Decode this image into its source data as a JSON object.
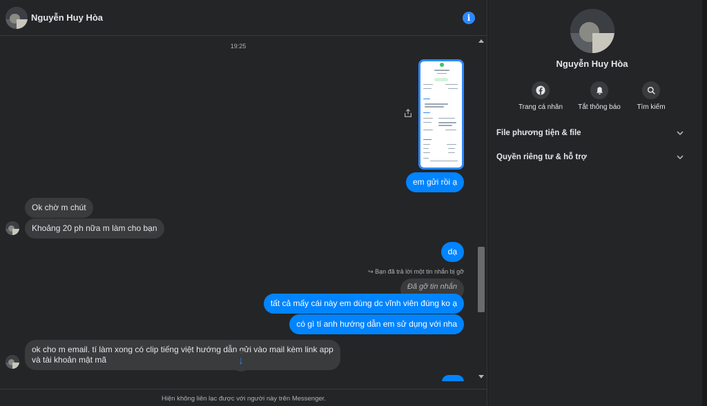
{
  "header": {
    "contact_name": "Nguyễn Huy Hòa",
    "info_icon": "info-icon"
  },
  "chat": {
    "timestamp": "19:25",
    "messages": [
      {
        "from": "me",
        "type": "image"
      },
      {
        "from": "me",
        "text": "em gửi rồi ạ"
      },
      {
        "from": "them",
        "text": "Ok chờ m chút"
      },
      {
        "from": "them",
        "text": "Khoảng 20 ph nữa m làm cho bạn"
      },
      {
        "from": "me",
        "text": "dạ"
      },
      {
        "from": "me",
        "reply_note": "Bạn đã trả lời một tin nhắn bị gỡ",
        "removed_text": "Đã gỡ tin nhắn"
      },
      {
        "from": "me",
        "text": "tất cả mấy cái này em dùng dc vĩnh viên đúng ko ạ"
      },
      {
        "from": "me",
        "text": "có gì tí anh hướng dẫn em sử dụng với nha"
      },
      {
        "from": "them",
        "text_line1": "ok cho m email. tí làm xong có clip tiếng việt hướng dẫn gửi vào mail kèm link app",
        "text_line2": "và tài khoản mật mã"
      }
    ],
    "footer_notice": "Hiện không liên lạc được với người này trên Messenger."
  },
  "side_panel": {
    "name": "Nguyễn Huy Hòa",
    "actions": [
      {
        "label": "Trang cá nhân",
        "icon": "facebook-icon"
      },
      {
        "label": "Tắt thông báo",
        "icon": "bell-icon"
      },
      {
        "label": "Tìm kiếm",
        "icon": "search-icon"
      }
    ],
    "sections": [
      {
        "label": "File phương tiện & file"
      },
      {
        "label": "Quyền riêng tư & hỗ trợ"
      }
    ]
  },
  "colors": {
    "accent": "#0084ff",
    "background": "#242526",
    "bubble_in": "#3a3b3c"
  }
}
